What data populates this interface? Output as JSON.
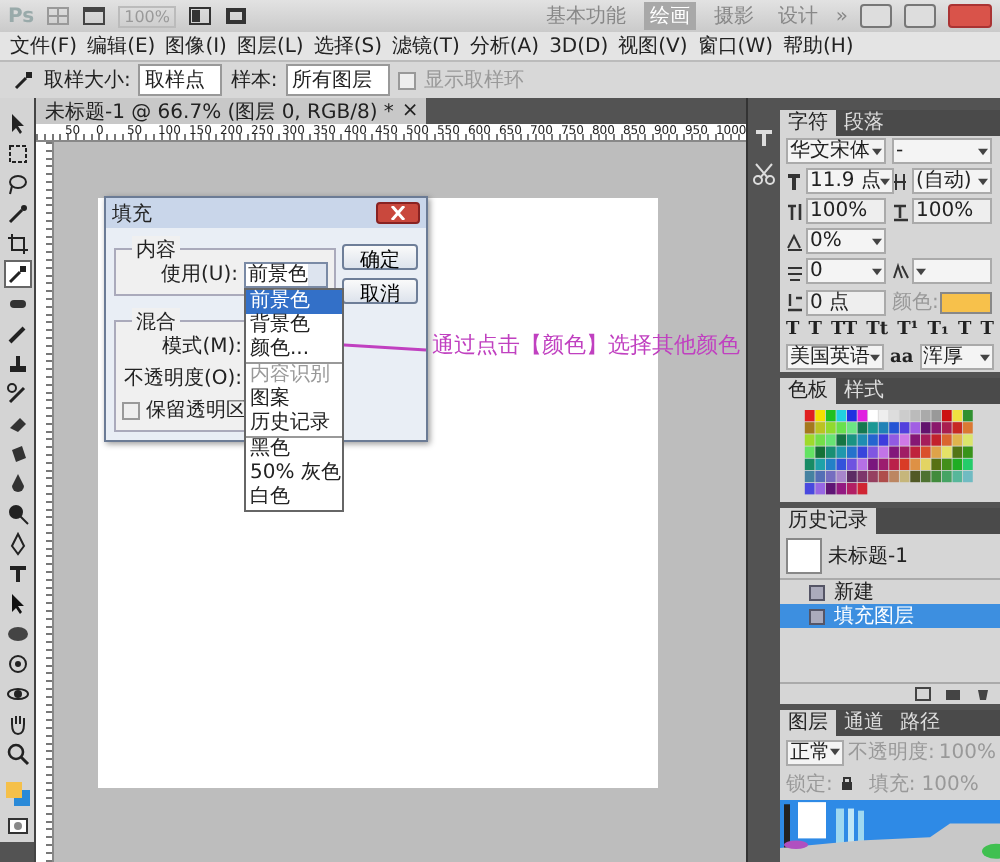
{
  "app_bar": {
    "logo": "Ps",
    "zoom": "100%",
    "workspaces": [
      {
        "label": "基本功能",
        "selected": false
      },
      {
        "label": "绘画",
        "selected": true
      },
      {
        "label": "摄影",
        "selected": false
      },
      {
        "label": "设计",
        "selected": false
      }
    ],
    "more": "»"
  },
  "menu": [
    "文件(F)",
    "编辑(E)",
    "图像(I)",
    "图层(L)",
    "选择(S)",
    "滤镜(T)",
    "分析(A)",
    "3D(D)",
    "视图(V)",
    "窗口(W)",
    "帮助(H)"
  ],
  "options_bar": {
    "sample_size_label": "取样大小:",
    "sample_size": "取样点",
    "sample_label": "样本:",
    "sample": "所有图层",
    "show_ring": {
      "label": "显示取样环",
      "checked": false,
      "disabled": true
    }
  },
  "tools": [
    {
      "kind": "move",
      "selected": false
    },
    {
      "kind": "marquee",
      "selected": false
    },
    {
      "kind": "lasso",
      "selected": false
    },
    {
      "kind": "wand",
      "selected": false
    },
    {
      "kind": "crop",
      "selected": false
    },
    {
      "kind": "eyedropper",
      "selected": true
    },
    {
      "kind": "bandage",
      "selected": false
    },
    {
      "kind": "brush",
      "selected": false
    },
    {
      "kind": "stamp",
      "selected": false
    },
    {
      "kind": "history-brush",
      "selected": false
    },
    {
      "kind": "eraser",
      "selected": false
    },
    {
      "kind": "bucket",
      "selected": false
    },
    {
      "kind": "drop",
      "selected": false
    },
    {
      "kind": "dodge",
      "selected": false
    },
    {
      "kind": "pen",
      "selected": false
    },
    {
      "kind": "text",
      "selected": false
    },
    {
      "kind": "pointer",
      "selected": false
    },
    {
      "kind": "ellipse",
      "selected": false
    },
    {
      "kind": "rotate",
      "selected": false
    },
    {
      "kind": "orbit",
      "selected": false
    },
    {
      "kind": "hand",
      "selected": false
    },
    {
      "kind": "zoom",
      "selected": false
    }
  ],
  "document": {
    "tab": "未标题-1 @ 66.7% (图层 0, RGB/8) *",
    "close": "×",
    "ruler": [
      "50",
      "0",
      "50",
      "100",
      "150",
      "200",
      "250",
      "300",
      "350",
      "400",
      "450",
      "500",
      "550",
      "600",
      "650",
      "700",
      "750",
      "800",
      "850",
      "900",
      "950",
      "1000"
    ]
  },
  "fill_dialog": {
    "title": "填充",
    "content_legend": "内容",
    "use_label": "使用(U):",
    "use_value": "前景色",
    "blend_legend": "混合",
    "mode_label": "模式(M):",
    "opacity_label": "不透明度(O):",
    "preserve": {
      "label": "保留透明区",
      "checked": false
    },
    "buttons": [
      "确定",
      "取消"
    ],
    "options": [
      [
        {
          "label": "前景色",
          "selected": true,
          "disabled": false
        },
        {
          "label": "背景色",
          "selected": false,
          "disabled": false
        },
        {
          "label": "颜色...",
          "selected": false,
          "disabled": false
        }
      ],
      [
        {
          "label": "内容识别",
          "selected": false,
          "disabled": true
        },
        {
          "label": "图案",
          "selected": false,
          "disabled": false
        },
        {
          "label": "历史记录",
          "selected": false,
          "disabled": false
        }
      ],
      [
        {
          "label": "黑色",
          "selected": false,
          "disabled": false
        },
        {
          "label": "50% 灰色",
          "selected": false,
          "disabled": false
        },
        {
          "label": "白色",
          "selected": false,
          "disabled": false
        }
      ]
    ]
  },
  "annotation": "通过点击【颜色】选择其他颜色",
  "character_panel": {
    "tabs": [
      {
        "label": "字符",
        "selected": true
      },
      {
        "label": "段落",
        "selected": false
      }
    ],
    "rows": [
      [
        {
          "kind": "select",
          "value": "华文宋体"
        },
        {
          "kind": "select",
          "value": "-"
        }
      ],
      [
        {
          "kind": "select",
          "value": "11.9 点"
        },
        {
          "kind": "select",
          "value": "(自动)"
        }
      ],
      [
        {
          "kind": "field",
          "value": "100%"
        },
        {
          "kind": "field",
          "value": "100%"
        }
      ],
      [
        {
          "kind": "select",
          "value": "0%"
        }
      ],
      [
        {
          "kind": "select",
          "value": "0"
        },
        {
          "kind": "select"
        }
      ],
      [
        {
          "kind": "field",
          "value": "0 点"
        },
        {
          "kind": "color",
          "label": "颜色:"
        }
      ]
    ],
    "styles": [
      "T",
      "T",
      "TT",
      "Tt",
      "T¹",
      "T₁",
      "T",
      "T"
    ],
    "language": "美国英语",
    "antialias_icon": "aa",
    "antialias": "浑厚"
  },
  "swatches_panel": {
    "tabs": [
      {
        "label": "色板",
        "selected": true
      },
      {
        "label": "样式",
        "selected": false
      }
    ]
  },
  "history_panel": {
    "tabs": [
      {
        "label": "历史记录",
        "selected": true
      }
    ],
    "snapshot": "未标题-1",
    "items": [
      {
        "label": "新建",
        "selected": false
      },
      {
        "label": "填充图层",
        "selected": true
      }
    ]
  },
  "layers_panel": {
    "tabs": [
      {
        "label": "图层",
        "selected": true
      },
      {
        "label": "通道",
        "selected": false
      },
      {
        "label": "路径",
        "selected": false
      }
    ],
    "blend": "正常",
    "opacity_label": "不透明度:",
    "opacity": "100%",
    "lock_label": "锁定:",
    "fill_label": "填充:",
    "fill": "100%"
  }
}
